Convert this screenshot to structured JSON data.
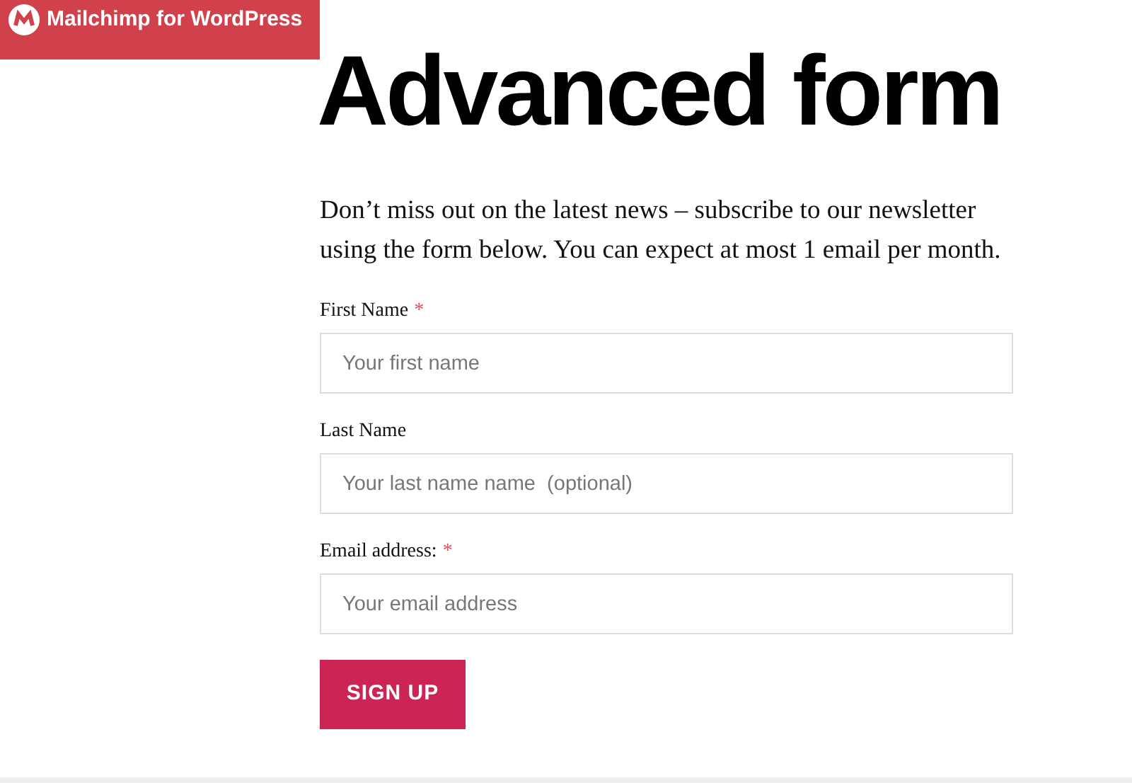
{
  "banner": {
    "title": "Mailchimp for WordPress"
  },
  "heading": "Advanced form",
  "intro": "Don’t miss out on the latest news – subscribe to our newsletter using the form below. You can expect at most 1 email per month.",
  "fields": [
    {
      "label": "First Name",
      "required_mark": "*",
      "placeholder": "Your first name"
    },
    {
      "label": "Last Name",
      "placeholder": "Your last name name  (optional)"
    },
    {
      "label": "Email address:",
      "required_mark": "*",
      "placeholder": "Your email address"
    }
  ],
  "submit": "SIGN UP"
}
